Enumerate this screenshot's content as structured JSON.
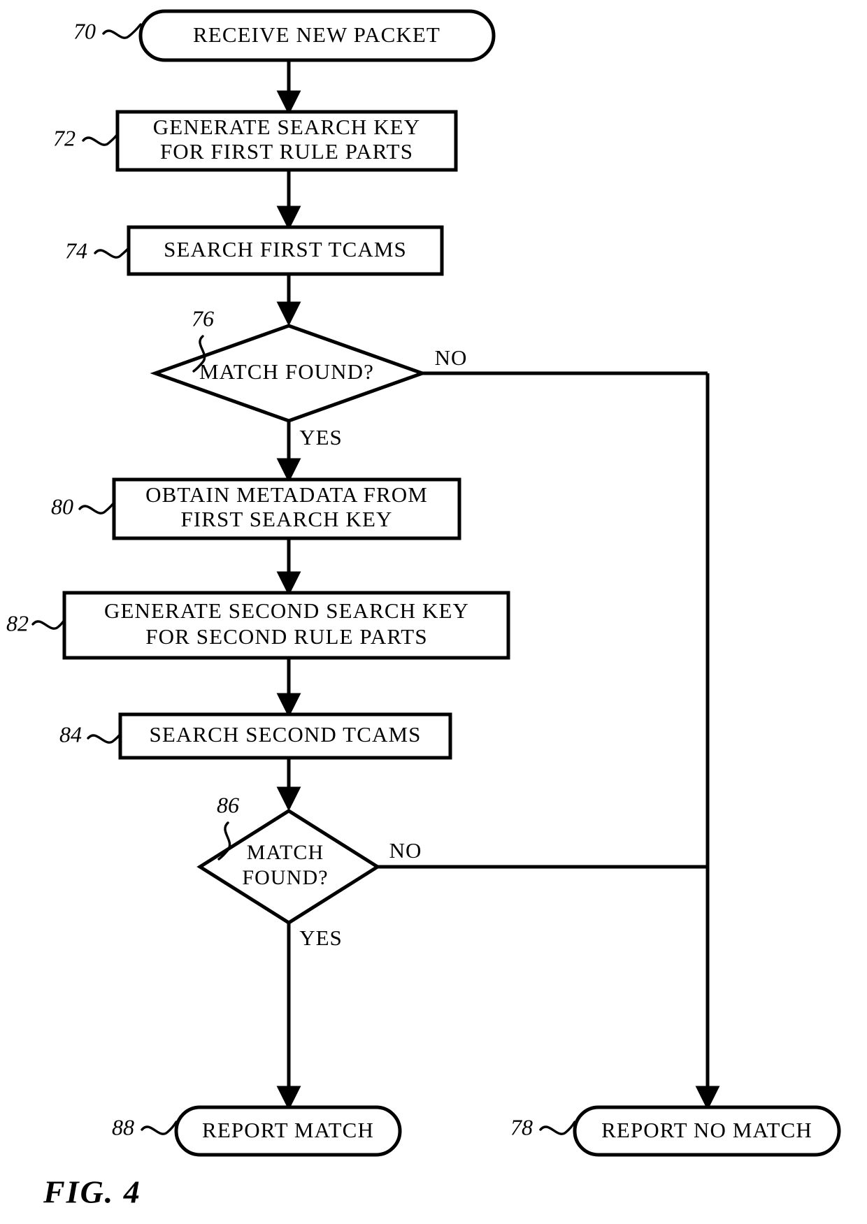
{
  "figure": {
    "caption": "FIG. 4",
    "title": "Packet classification flowchart with two-stage TCAM search"
  },
  "nodes": [
    {
      "id": "start",
      "ref": "70",
      "shape": "terminator",
      "lines": [
        "RECEIVE NEW PACKET"
      ]
    },
    {
      "id": "gen-first-key",
      "ref": "72",
      "shape": "process",
      "lines": [
        "GENERATE SEARCH KEY",
        "FOR FIRST RULE PARTS"
      ]
    },
    {
      "id": "search-first-tcams",
      "ref": "74",
      "shape": "process",
      "lines": [
        "SEARCH FIRST TCAMS"
      ]
    },
    {
      "id": "first-match-decision",
      "ref": "76",
      "shape": "decision",
      "lines": [
        "MATCH FOUND?"
      ]
    },
    {
      "id": "obtain-metadata",
      "ref": "80",
      "shape": "process",
      "lines": [
        "OBTAIN METADATA FROM",
        "FIRST SEARCH KEY"
      ]
    },
    {
      "id": "gen-second-key",
      "ref": "82",
      "shape": "process",
      "lines": [
        "GENERATE SECOND SEARCH KEY",
        "FOR SECOND RULE PARTS"
      ]
    },
    {
      "id": "search-second-tcams",
      "ref": "84",
      "shape": "process",
      "lines": [
        "SEARCH SECOND TCAMS"
      ]
    },
    {
      "id": "second-match-decision",
      "ref": "86",
      "shape": "decision",
      "lines": [
        "MATCH",
        "FOUND?"
      ]
    },
    {
      "id": "report-match",
      "ref": "88",
      "shape": "terminator",
      "lines": [
        "REPORT MATCH"
      ]
    },
    {
      "id": "report-no-match",
      "ref": "78",
      "shape": "terminator",
      "lines": [
        "REPORT NO MATCH"
      ]
    }
  ],
  "branch_labels": {
    "first_no": "NO",
    "first_yes": "YES",
    "second_no": "NO",
    "second_yes": "YES"
  },
  "colors": {
    "stroke": "#000000",
    "fill": "#ffffff",
    "background": "#ffffff"
  }
}
